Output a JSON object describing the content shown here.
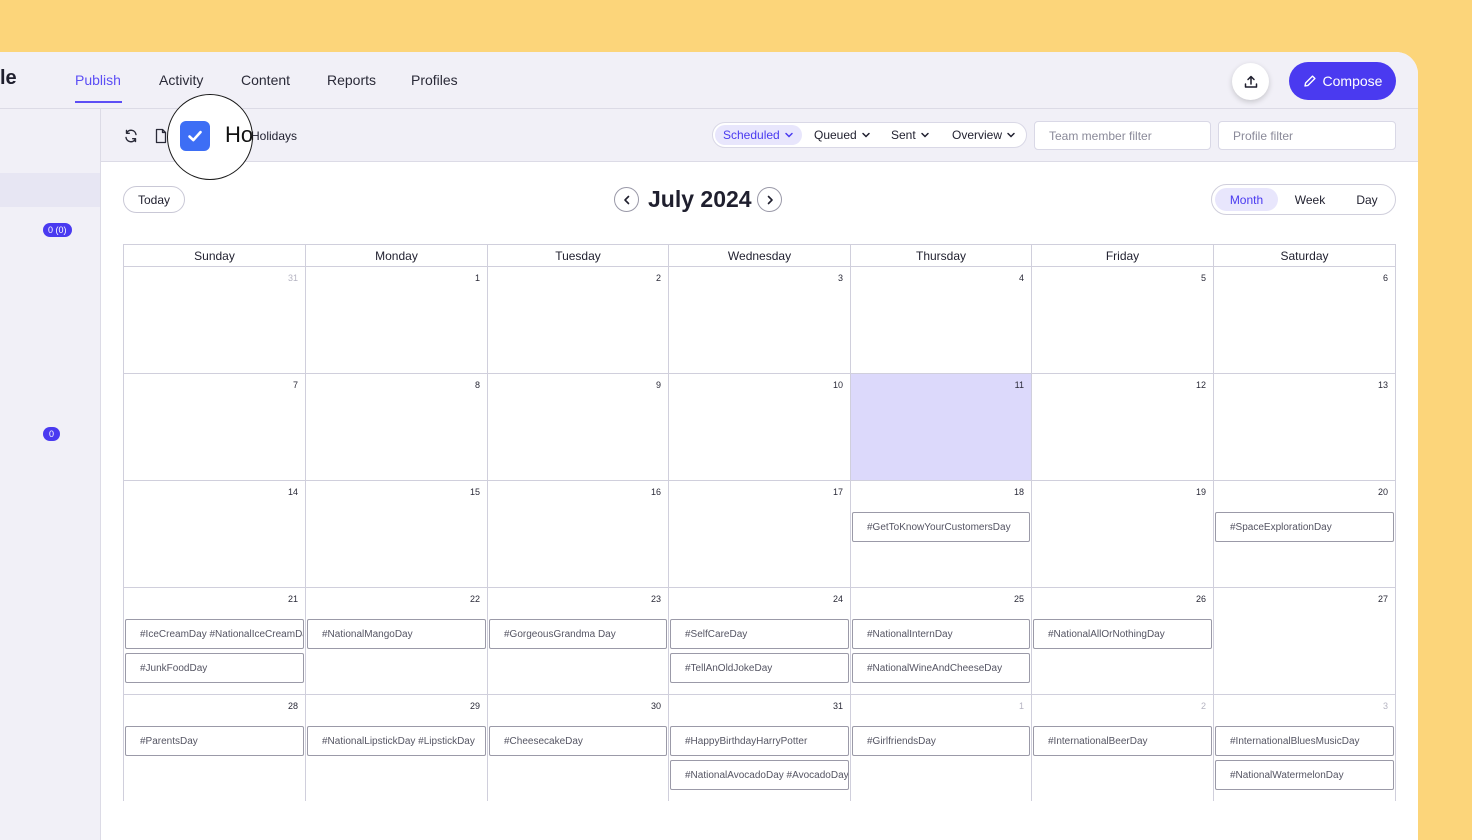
{
  "topnav": {
    "logo_fragment": "le",
    "tabs": [
      "Publish",
      "Activity",
      "Content",
      "Reports",
      "Profiles"
    ],
    "active_tab": "Publish",
    "compose_label": "Compose",
    "accent": "#4a3af0"
  },
  "sidebar": {
    "badges": [
      "0 (0)",
      "0"
    ]
  },
  "toolbar": {
    "holidays_label": "Holidays",
    "magnifier_text": "Ho",
    "holidays_checked": true,
    "filters": [
      "Scheduled",
      "Queued",
      "Sent",
      "Overview"
    ],
    "active_filter": "Scheduled",
    "team_member_placeholder": "Team member filter",
    "profile_placeholder": "Profile filter"
  },
  "calendar": {
    "today_label": "Today",
    "month_title": "July 2024",
    "views": [
      "Month",
      "Week",
      "Day"
    ],
    "active_view": "Month",
    "weekdays": [
      "Sunday",
      "Monday",
      "Tuesday",
      "Wednesday",
      "Thursday",
      "Friday",
      "Saturday"
    ],
    "today_date": "11",
    "weeks": [
      [
        {
          "day": "31",
          "muted": true,
          "events": []
        },
        {
          "day": "1",
          "events": []
        },
        {
          "day": "2",
          "events": []
        },
        {
          "day": "3",
          "events": []
        },
        {
          "day": "4",
          "events": []
        },
        {
          "day": "5",
          "events": []
        },
        {
          "day": "6",
          "events": []
        }
      ],
      [
        {
          "day": "7",
          "events": []
        },
        {
          "day": "8",
          "events": []
        },
        {
          "day": "9",
          "events": []
        },
        {
          "day": "10",
          "events": []
        },
        {
          "day": "11",
          "today": true,
          "events": []
        },
        {
          "day": "12",
          "events": []
        },
        {
          "day": "13",
          "events": []
        }
      ],
      [
        {
          "day": "14",
          "events": []
        },
        {
          "day": "15",
          "events": []
        },
        {
          "day": "16",
          "events": []
        },
        {
          "day": "17",
          "events": []
        },
        {
          "day": "18",
          "events": [
            "#GetToKnowYourCustomersDay"
          ]
        },
        {
          "day": "19",
          "events": []
        },
        {
          "day": "20",
          "events": [
            "#SpaceExplorationDay"
          ]
        }
      ],
      [
        {
          "day": "21",
          "events": [
            "#IceCreamDay #NationalIceCreamDay",
            "#JunkFoodDay"
          ]
        },
        {
          "day": "22",
          "events": [
            "#NationalMangoDay"
          ]
        },
        {
          "day": "23",
          "events": [
            "#GorgeousGrandma Day"
          ]
        },
        {
          "day": "24",
          "events": [
            "#SelfCareDay",
            "#TellAnOldJokeDay"
          ]
        },
        {
          "day": "25",
          "events": [
            "#NationalInternDay",
            "#NationalWineAndCheeseDay"
          ]
        },
        {
          "day": "26",
          "events": [
            "#NationalAllOrNothingDay"
          ]
        },
        {
          "day": "27",
          "events": []
        }
      ],
      [
        {
          "day": "28",
          "events": [
            "#ParentsDay"
          ]
        },
        {
          "day": "29",
          "events": [
            "#NationalLipstickDay #LipstickDay"
          ]
        },
        {
          "day": "30",
          "events": [
            "#CheesecakeDay"
          ]
        },
        {
          "day": "31",
          "events": [
            "#HappyBirthdayHarryPotter",
            "#NationalAvocadoDay #AvocadoDay"
          ]
        },
        {
          "day": "1",
          "muted": true,
          "events": [
            "#GirlfriendsDay"
          ]
        },
        {
          "day": "2",
          "muted": true,
          "events": [
            "#InternationalBeerDay"
          ]
        },
        {
          "day": "3",
          "muted": true,
          "events": [
            "#InternationalBluesMusicDay",
            "#NationalWatermelonDay"
          ]
        }
      ]
    ]
  }
}
